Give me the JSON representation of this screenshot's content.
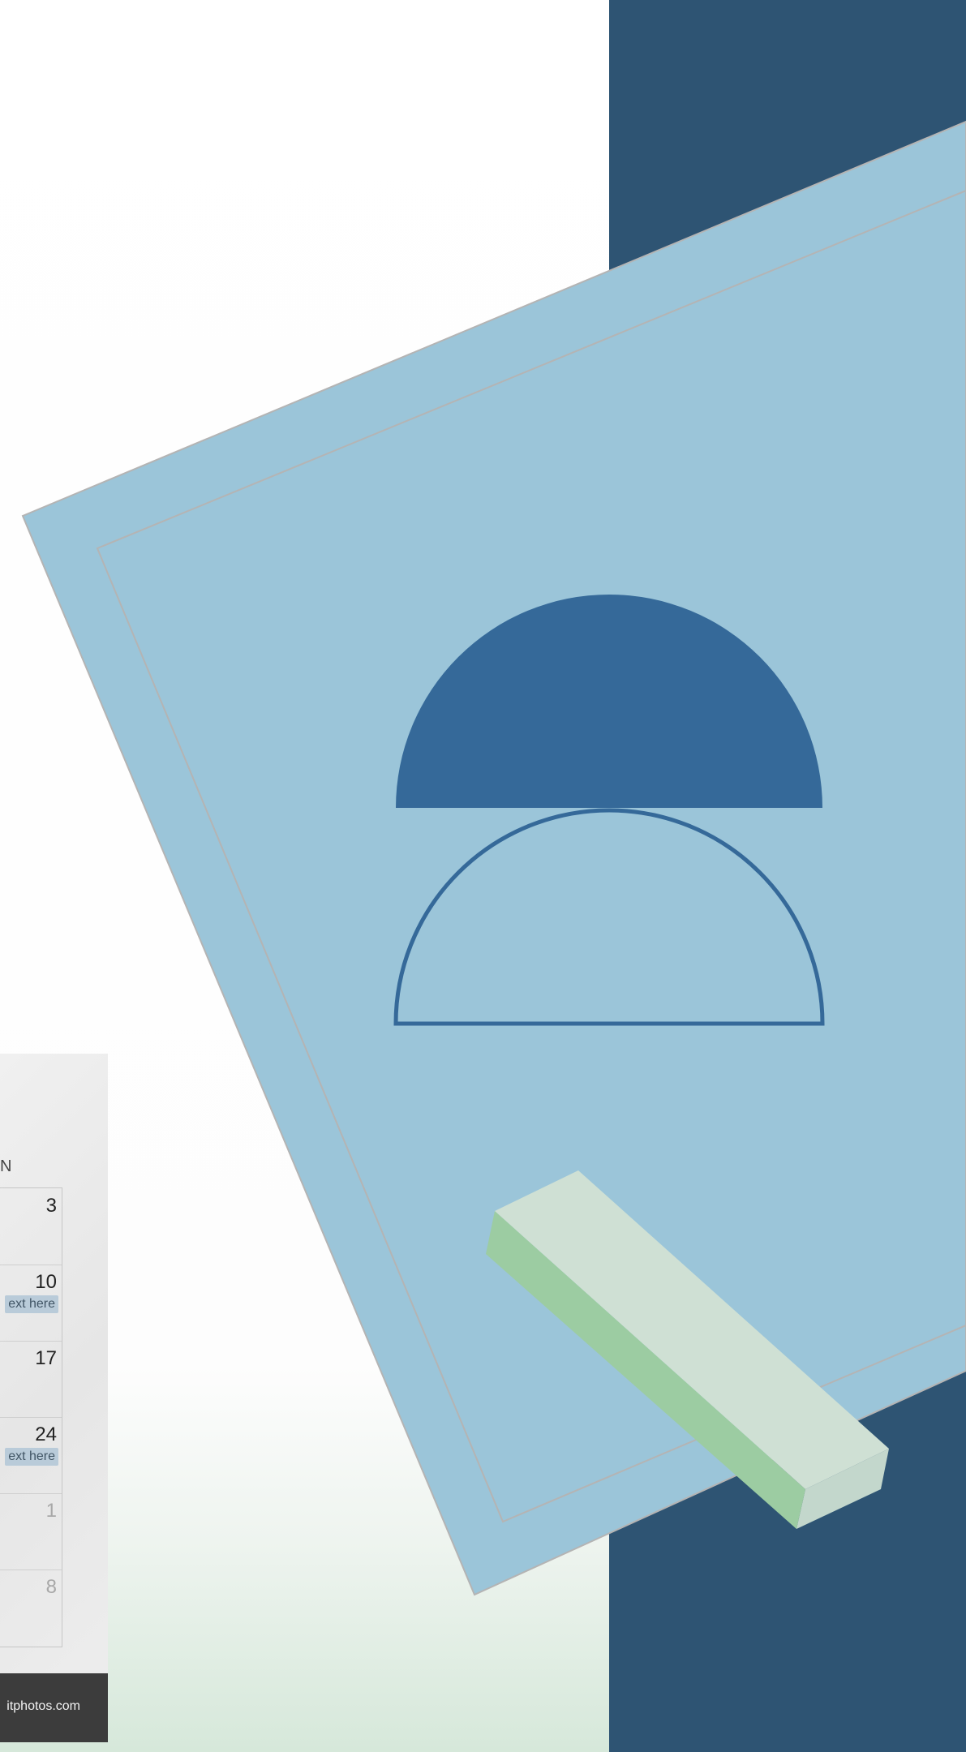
{
  "colors": {
    "navy_panel": "#2e5473",
    "frame_blue": "#9bc5d9",
    "semicircle_blue": "#356999",
    "bar_top": "#cfe0d4",
    "bar_front": "#9ccca2",
    "bar_end": "#c3d7cc"
  },
  "icons": [
    "calendar-clip-icon"
  ],
  "calendar": {
    "column_label": "N",
    "cells": [
      {
        "day": "3",
        "note": "",
        "dim": false
      },
      {
        "day": "10",
        "note": "ext here",
        "dim": false
      },
      {
        "day": "17",
        "note": "",
        "dim": false
      },
      {
        "day": "24",
        "note": "ext here",
        "dim": false
      },
      {
        "day": "1",
        "note": "",
        "dim": true
      },
      {
        "day": "8",
        "note": "",
        "dim": true
      }
    ],
    "footer_text": "itphotos.com"
  }
}
